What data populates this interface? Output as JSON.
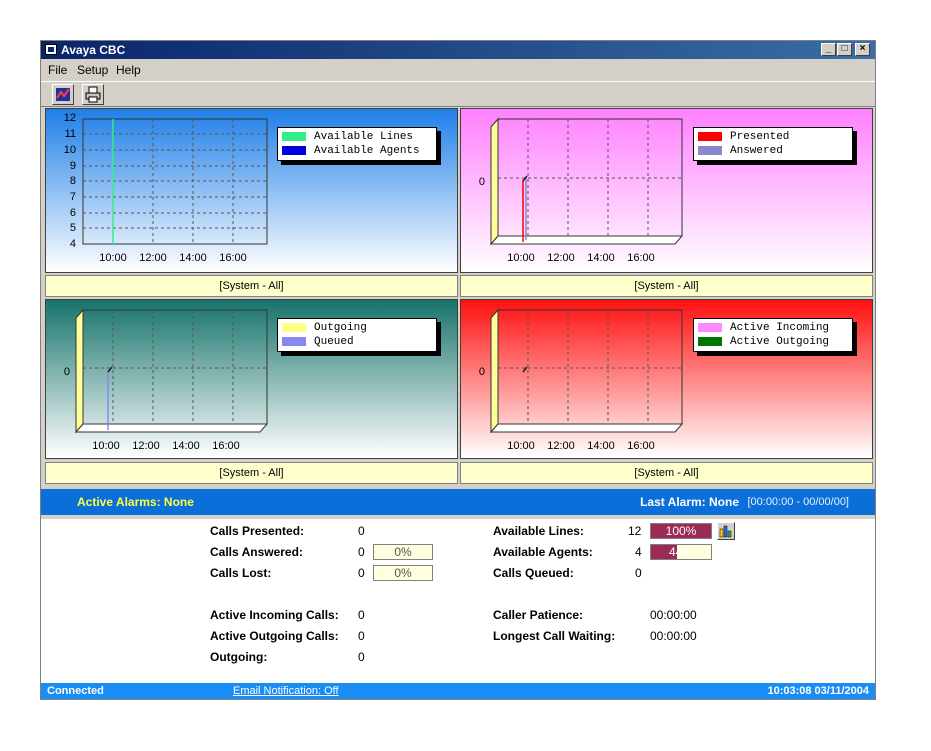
{
  "window": {
    "title": "Avaya CBC"
  },
  "menu": [
    "File",
    "Setup",
    "Help"
  ],
  "toolbar": {
    "buttons": [
      "chart-icon",
      "printer-icon"
    ]
  },
  "charts": [
    {
      "id": "lines-agents",
      "caption": "[System - All]",
      "legend": [
        {
          "label": "Available Lines",
          "color": "#33ee88"
        },
        {
          "label": "Available Agents",
          "color": "#0000dd"
        }
      ],
      "y_ticks": [
        "12",
        "11",
        "10",
        "9",
        "8",
        "7",
        "6",
        "5",
        "4"
      ],
      "x_ticks": [
        "10:00",
        "12:00",
        "14:00",
        "16:00"
      ]
    },
    {
      "id": "presented-answered",
      "caption": "[System - All]",
      "legend": [
        {
          "label": "Presented",
          "color": "#ff0000"
        },
        {
          "label": "Answered",
          "color": "#8888cc"
        }
      ],
      "y_ticks": [
        "0"
      ],
      "x_ticks": [
        "10:00",
        "12:00",
        "14:00",
        "16:00"
      ]
    },
    {
      "id": "outgoing-queued",
      "caption": "[System - All]",
      "legend": [
        {
          "label": "Outgoing",
          "color": "#ffff88"
        },
        {
          "label": "Queued",
          "color": "#8888ee"
        }
      ],
      "y_ticks": [
        "0"
      ],
      "x_ticks": [
        "10:00",
        "12:00",
        "14:00",
        "16:00"
      ]
    },
    {
      "id": "active-calls",
      "caption": "[System - All]",
      "legend": [
        {
          "label": "Active Incoming",
          "color": "#ff88ff"
        },
        {
          "label": "Active Outgoing",
          "color": "#007700"
        }
      ],
      "y_ticks": [
        "0"
      ],
      "x_ticks": [
        "10:00",
        "12:00",
        "14:00",
        "16:00"
      ]
    }
  ],
  "alarms": {
    "active": "Active Alarms: None",
    "last": "Last Alarm: None",
    "last_range": "[00:00:00 - 00/00/00]"
  },
  "stats": {
    "calls_presented": {
      "label": "Calls Presented:",
      "value": "0"
    },
    "calls_answered": {
      "label": "Calls Answered:",
      "value": "0",
      "pct": "0%"
    },
    "calls_lost": {
      "label": "Calls Lost:",
      "value": "0",
      "pct": "0%"
    },
    "active_incoming": {
      "label": "Active Incoming Calls:",
      "value": "0"
    },
    "active_outgoing": {
      "label": "Active Outgoing Calls:",
      "value": "0"
    },
    "outgoing": {
      "label": "Outgoing:",
      "value": "0"
    },
    "available_lines": {
      "label": "Available Lines:",
      "value": "12",
      "pct": "100%",
      "fraction": 1.0
    },
    "available_agents": {
      "label": "Available Agents:",
      "value": "4",
      "pct": "44%",
      "fraction": 0.44
    },
    "calls_queued": {
      "label": "Calls Queued:",
      "value": "0"
    },
    "caller_patience": {
      "label": "Caller Patience:",
      "value": "00:00:00"
    },
    "longest_wait": {
      "label": "Longest Call Waiting:",
      "value": "00:00:00"
    }
  },
  "status": {
    "connection": "Connected",
    "email": "Email Notification: Off",
    "datetime": "10:03:08  03/11/2004"
  }
}
